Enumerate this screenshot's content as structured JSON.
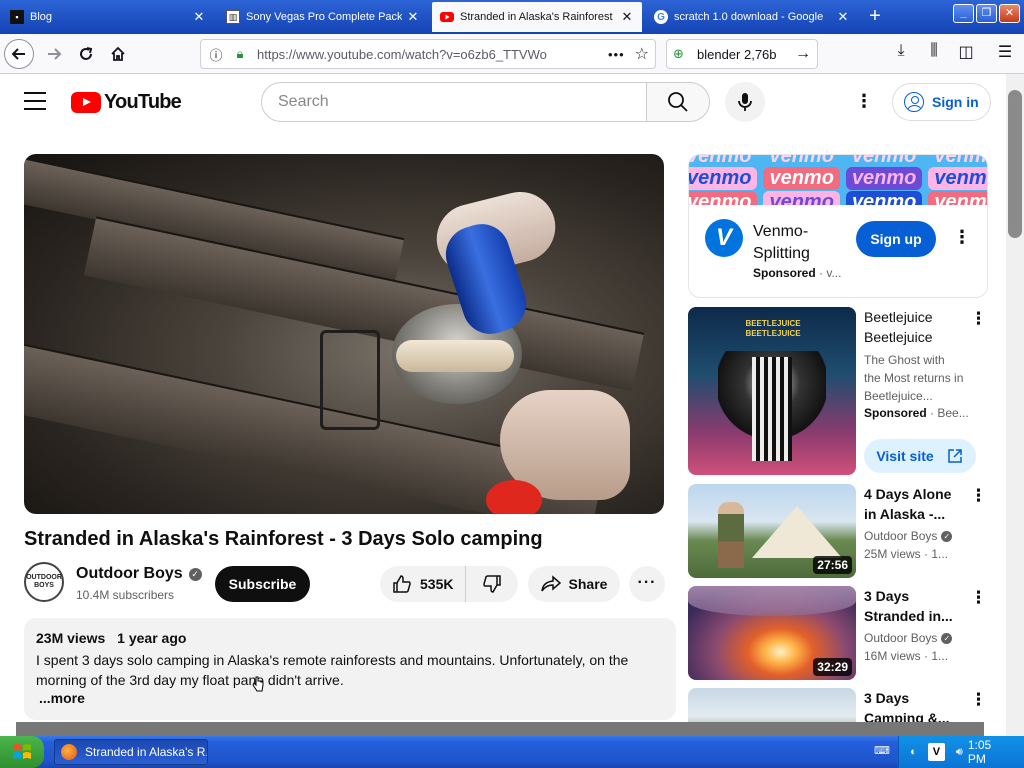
{
  "browser": {
    "tabs": [
      {
        "title": "Blog",
        "icon": "terminal-favicon-icon"
      },
      {
        "title": "Sony Vegas Pro Complete Pack",
        "icon": "column-favicon-icon"
      },
      {
        "title": "Stranded in Alaska's Rainforest",
        "icon": "youtube-favicon-icon",
        "active": true
      },
      {
        "title": "scratch 1.0 download - Google",
        "icon": "google-favicon-icon"
      }
    ],
    "new_tab": "+",
    "url": "https://www.youtube.com/watch?v=o6zb6_TTVWo",
    "search_query": "blender 2,76b"
  },
  "youtube": {
    "logo_text": "YouTube",
    "search_placeholder": "Search",
    "sign_in": "Sign in"
  },
  "video": {
    "title": "Stranded in Alaska's Rainforest - 3 Days Solo camping",
    "channel": "Outdoor Boys",
    "channel_avatar_text": "OUTDOOR BOYS",
    "subscribers": "10.4M subscribers",
    "subscribe_label": "Subscribe",
    "likes": "535K",
    "share_label": "Share",
    "views": "23M views",
    "age": "1 year ago",
    "description": "I spent 3 days solo camping in Alaska's remote rainforests and mountains. Unfortunately, on the morning of the 3rd day my float pane didn't arrive.",
    "more_label": "...more"
  },
  "sidebar": {
    "ad": {
      "banner_word": "venmo",
      "logo_letter": "V",
      "title": "Venmo-Splitting",
      "sponsored": "Sponsored",
      "sponsor_suffix": "· v...",
      "cta": "Sign up"
    },
    "items": [
      {
        "title": "Beetlejuice Beetlejuice",
        "thumb_text": "BEETLEJUICE BEETLEJUICE",
        "line1": "The Ghost with the Most returns in Beetlejuice...",
        "sponsored": "Sponsored",
        "sponsor_suffix": "· Bee...",
        "cta": "Visit site"
      },
      {
        "title": "4 Days Alone in Alaska -...",
        "channel": "Outdoor Boys",
        "meta": "25M views · 1...",
        "duration": "27:56"
      },
      {
        "title": "3 Days Stranded in...",
        "channel": "Outdoor Boys",
        "meta": "16M views · 1...",
        "duration": "32:29"
      },
      {
        "title": "3 Days Camping &..."
      }
    ]
  },
  "taskbar": {
    "start_label": "start",
    "window_title": "Stranded in Alaska's R...",
    "clock": "1:05 PM"
  },
  "colors": {
    "youtube_red": "#ff0000",
    "link_blue": "#065fd4",
    "venmo_blue": "#0074de"
  }
}
